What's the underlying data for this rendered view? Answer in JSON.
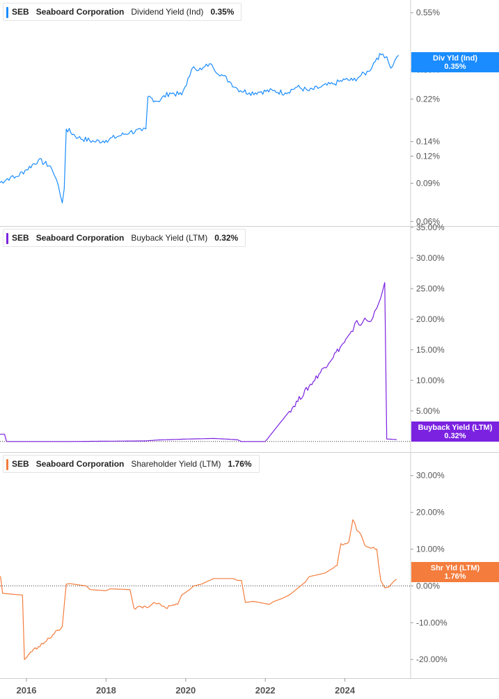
{
  "panels": [
    {
      "ticker": "SEB",
      "company": "Seaboard Corporation",
      "metric": "Dividend Yield (Ind)",
      "value": "0.35%",
      "color": "#1a8cff",
      "tag_label": "Div Yld (Ind)",
      "tag_value": "0.35%",
      "axis_scale": "log",
      "y_ticks": [
        "0.55%",
        "0.30%",
        "0.22%",
        "0.14%",
        "0.12%",
        "0.09%",
        "0.06%"
      ],
      "zero_line": false
    },
    {
      "ticker": "SEB",
      "company": "Seaboard Corporation",
      "metric": "Buyback Yield (LTM)",
      "value": "0.32%",
      "color": "#7b22e0",
      "tag_label": "Buyback Yield (LTM)",
      "tag_value": "0.32%",
      "axis_scale": "linear",
      "y_ticks": [
        "35.00%",
        "30.00%",
        "25.00%",
        "20.00%",
        "15.00%",
        "10.00%",
        "5.00%"
      ],
      "zero_line": true
    },
    {
      "ticker": "SEB",
      "company": "Seaboard Corporation",
      "metric": "Shareholder Yield (LTM)",
      "value": "1.76%",
      "color": "#f47c3c",
      "tag_label": "Shr Yld (LTM)",
      "tag_value": "1.76%",
      "axis_scale": "linear",
      "y_ticks": [
        "30.00%",
        "20.00%",
        "10.00%",
        "0.00%",
        "-10.00%",
        "-20.00%"
      ],
      "zero_line": true
    }
  ],
  "x_ticks": [
    "2016",
    "2018",
    "2020",
    "2022",
    "2024"
  ],
  "chart_data": [
    {
      "type": "line",
      "title": "SEB Seaboard Corporation Dividend Yield (Ind)",
      "ylabel": "Dividend Yield (Ind) %",
      "y_scale": "log",
      "ylim": [
        0.058,
        0.62
      ],
      "series": [
        {
          "name": "Dividend Yield (Ind)",
          "x": [
            2015.3,
            2015.6,
            2015.7,
            2016.0,
            2016.3,
            2016.6,
            2016.7,
            2016.8,
            2016.9,
            2016.95,
            2017.0,
            2017.3,
            2017.7,
            2018.0,
            2018.3,
            2018.6,
            2018.9,
            2019.0,
            2019.05,
            2019.3,
            2019.6,
            2019.9,
            2020.1,
            2020.2,
            2020.4,
            2020.6,
            2020.7,
            2020.9,
            2021.1,
            2021.3,
            2021.6,
            2021.9,
            2022.2,
            2022.5,
            2022.8,
            2023.1,
            2023.4,
            2023.7,
            2024.0,
            2024.2,
            2024.4,
            2024.6,
            2024.8,
            2024.95,
            2025.05,
            2025.15,
            2025.25,
            2025.35
          ],
          "values": [
            0.09,
            0.096,
            0.095,
            0.104,
            0.115,
            0.108,
            0.098,
            0.088,
            0.073,
            0.085,
            0.16,
            0.146,
            0.14,
            0.142,
            0.148,
            0.155,
            0.157,
            0.16,
            0.225,
            0.215,
            0.235,
            0.23,
            0.28,
            0.31,
            0.3,
            0.32,
            0.305,
            0.285,
            0.265,
            0.245,
            0.235,
            0.238,
            0.24,
            0.235,
            0.25,
            0.24,
            0.25,
            0.258,
            0.27,
            0.268,
            0.282,
            0.295,
            0.34,
            0.355,
            0.345,
            0.305,
            0.33,
            0.35
          ]
        }
      ]
    },
    {
      "type": "line",
      "title": "SEB Seaboard Corporation Buyback Yield (LTM)",
      "ylabel": "Buyback Yield (LTM) %",
      "ylim": [
        -1.5,
        35
      ],
      "series": [
        {
          "name": "Buyback Yield (LTM)",
          "x": [
            2015.3,
            2015.45,
            2015.5,
            2016.0,
            2017.0,
            2018.0,
            2019.0,
            2019.3,
            2020.0,
            2020.7,
            2021.3,
            2021.4,
            2022.0,
            2024.2,
            2024.3,
            2024.4,
            2024.5,
            2024.6,
            2024.7,
            2024.8,
            2024.9,
            2025.0,
            2025.05,
            2025.1,
            2025.3
          ],
          "values": [
            1.2,
            1.2,
            0.0,
            0.0,
            0.0,
            0.05,
            0.1,
            0.25,
            0.4,
            0.5,
            0.3,
            0.0,
            0.0,
            18.0,
            19.8,
            19.0,
            20.2,
            19.6,
            20.2,
            21.8,
            23.5,
            26.0,
            0.4,
            0.4,
            0.32
          ]
        }
      ]
    },
    {
      "type": "line",
      "title": "SEB Seaboard Corporation Shareholder Yield (LTM)",
      "ylabel": "Shareholder Yield (LTM) %",
      "ylim": [
        -24.5,
        36
      ],
      "series": [
        {
          "name": "Shareholder Yield (LTM)",
          "x": [
            2015.3,
            2015.35,
            2015.4,
            2015.9,
            2015.95,
            2016.0,
            2016.1,
            2016.3,
            2016.5,
            2016.7,
            2016.9,
            2017.0,
            2017.1,
            2017.5,
            2017.6,
            2018.0,
            2018.1,
            2018.6,
            2018.7,
            2019.1,
            2019.2,
            2019.4,
            2019.5,
            2019.8,
            2019.9,
            2020.1,
            2020.2,
            2020.4,
            2020.5,
            2020.7,
            2021.2,
            2021.3,
            2021.4,
            2021.5,
            2021.7,
            2022.1,
            2022.2,
            2022.4,
            2022.6,
            2023.0,
            2023.1,
            2023.5,
            2023.8,
            2023.9,
            2024.0,
            2024.1,
            2024.2,
            2024.25,
            2024.3,
            2024.4,
            2024.5,
            2024.6,
            2024.8,
            2024.9,
            2025.0,
            2025.1,
            2025.25,
            2025.3
          ],
          "values": [
            2.5,
            2.5,
            -2.0,
            -2.5,
            -20.0,
            -19.5,
            -18.0,
            -16.5,
            -15.0,
            -13.0,
            -11.0,
            0.5,
            0.6,
            0.0,
            -1.0,
            -1.3,
            -0.8,
            -1.0,
            -6.0,
            -5.5,
            -4.5,
            -5.5,
            -6.0,
            -5.0,
            -2.5,
            -1.0,
            0.0,
            0.5,
            1.0,
            2.0,
            2.0,
            1.5,
            1.5,
            -4.5,
            -4.2,
            -5.0,
            -4.3,
            -3.5,
            -2.5,
            1.0,
            2.5,
            3.5,
            5.5,
            11.5,
            11.5,
            12.0,
            18.0,
            17.0,
            15.0,
            14.0,
            11.0,
            10.5,
            10.0,
            1.5,
            -0.5,
            -0.3,
            1.5,
            1.76
          ]
        }
      ]
    }
  ]
}
